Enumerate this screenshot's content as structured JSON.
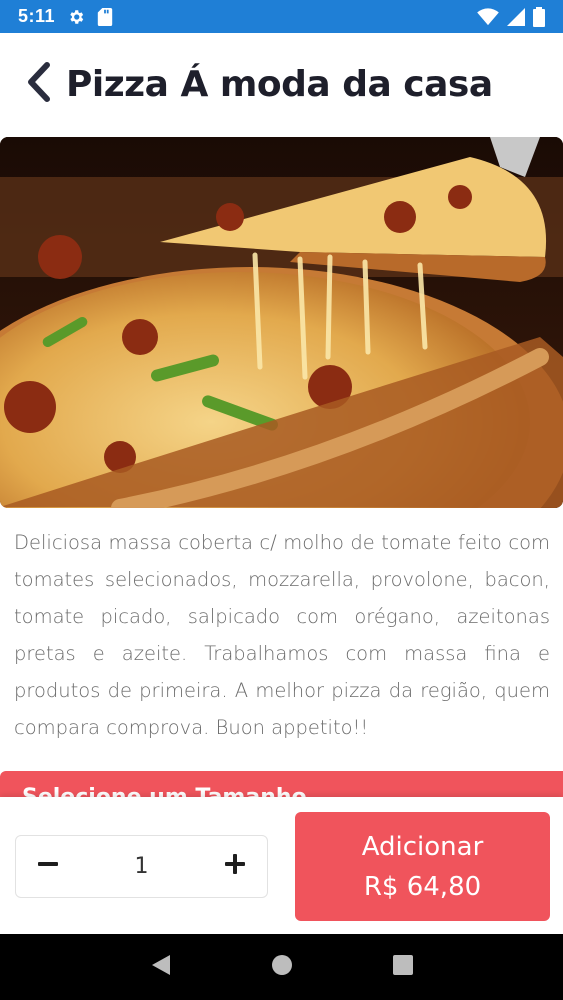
{
  "status_bar": {
    "time": "5:11",
    "icons": [
      "gear-icon",
      "sd-card-icon",
      "wifi-icon",
      "signal-icon",
      "battery-icon"
    ],
    "color": "#1f7fd6"
  },
  "header": {
    "title": "Pizza Á moda da casa",
    "back_icon": "chevron-left-icon"
  },
  "product": {
    "image_alt": "pizza-photo",
    "description": "Deliciosa massa coberta c/ molho de tomate feito com tomates selecionados, mozzarella, provolone, bacon, tomate picado, salpicado com orégano, azeitonas pretas e azeite. Trabalhamos com massa fina e produtos de primeira. A melhor pizza da região, quem compara comprova. Buon appetito!!"
  },
  "size_section": {
    "title": "Selecione um Tamanho"
  },
  "cart": {
    "quantity": "1",
    "add_label": "Adicionar",
    "price": "R$ 64,80",
    "accent": "#f0545c"
  },
  "nav": {
    "icons": [
      "back-triangle-icon",
      "home-circle-icon",
      "recents-square-icon"
    ]
  }
}
